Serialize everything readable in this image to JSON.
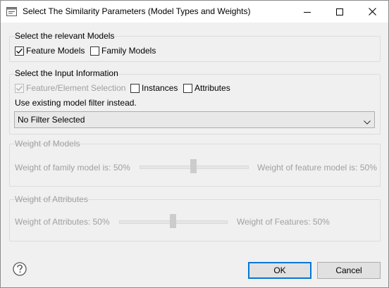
{
  "window": {
    "title": "Select The Similarity Parameters (Model Types and Weights)"
  },
  "models_group": {
    "title": "Select the relevant Models",
    "feature_models": {
      "label": "Feature Models",
      "checked": true
    },
    "family_models": {
      "label": "Family Models",
      "checked": false
    }
  },
  "input_group": {
    "title": "Select the Input Information",
    "feature_element_selection": {
      "label": "Feature/Element Selection",
      "checked": true,
      "enabled": false
    },
    "instances": {
      "label": "Instances",
      "checked": false
    },
    "attributes": {
      "label": "Attributes",
      "checked": false
    },
    "filter_hint": "Use existing model filter instead.",
    "filter_select": {
      "value": "No Filter Selected"
    }
  },
  "weight_models_group": {
    "title": "Weight of Models",
    "left_label": "Weight of family model is: 50%",
    "right_label": "Weight of feature model is: 50%",
    "value": 50
  },
  "weight_attributes_group": {
    "title": "Weight of Attributes",
    "left_label": "Weight of Attributes: 50%",
    "right_label": "Weight of Features: 50%",
    "value": 50
  },
  "buttons": {
    "ok": "OK",
    "cancel": "Cancel"
  },
  "icons": {
    "app": "window-app-icon",
    "help": "help-icon"
  }
}
